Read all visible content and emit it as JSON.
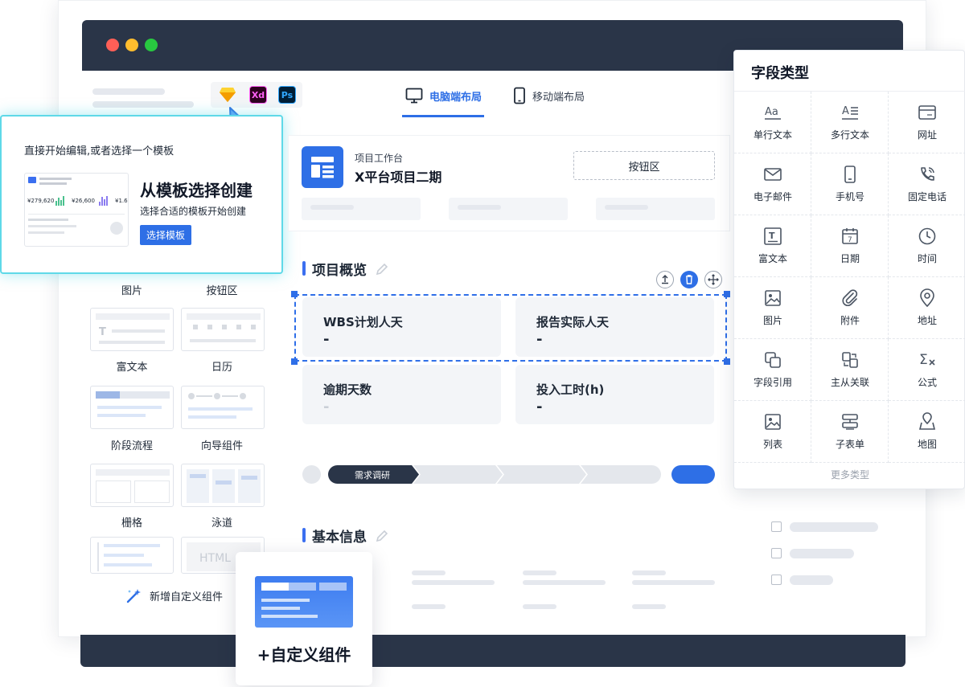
{
  "tools": [
    "Sketch",
    "Xd",
    "Ps"
  ],
  "tabs": {
    "desktop": "电脑端布局",
    "mobile": "移动端布局"
  },
  "template_panel": {
    "heading": "直接开始编辑,或者选择一个模板",
    "title": "从模板选择创建",
    "subtitle": "选择合适的模板开始创建",
    "button": "选择模板",
    "thumb_values": [
      "¥279,620",
      "¥26,600",
      "¥1.6"
    ]
  },
  "components": [
    {
      "label": "图片"
    },
    {
      "label": "按钮区"
    },
    {
      "label": "富文本"
    },
    {
      "label": "日历"
    },
    {
      "label": "阶段流程"
    },
    {
      "label": "向导组件"
    },
    {
      "label": "栅格"
    },
    {
      "label": "泳道"
    }
  ],
  "html_thumb_text": "HTML",
  "add_custom_link": "新增自定义组件",
  "add_custom_card": "+自定义组件",
  "project": {
    "workspace": "项目工作台",
    "name": "X平台项目二期",
    "button_area": "按钮区"
  },
  "overview": {
    "title": "项目概览",
    "stats": [
      {
        "label": "WBS计划人天",
        "value": "-"
      },
      {
        "label": "报告实际人天",
        "value": "-"
      },
      {
        "label": "逾期天数",
        "value": "-"
      },
      {
        "label": "投入工时(h)",
        "value": "-"
      }
    ]
  },
  "stage_bar": {
    "current": "需求调研"
  },
  "basic_info": {
    "title": "基本信息"
  },
  "field_panel": {
    "title": "字段类型",
    "fields": [
      {
        "label": "单行文本",
        "icon": "single-line-text-icon"
      },
      {
        "label": "多行文本",
        "icon": "multi-line-text-icon"
      },
      {
        "label": "网址",
        "icon": "url-icon"
      },
      {
        "label": "电子邮件",
        "icon": "email-icon"
      },
      {
        "label": "手机号",
        "icon": "mobile-phone-icon"
      },
      {
        "label": "固定电话",
        "icon": "landline-phone-icon"
      },
      {
        "label": "富文本",
        "icon": "rich-text-icon"
      },
      {
        "label": "日期",
        "icon": "calendar-icon"
      },
      {
        "label": "时间",
        "icon": "clock-icon"
      },
      {
        "label": "图片",
        "icon": "image-icon"
      },
      {
        "label": "附件",
        "icon": "paperclip-icon"
      },
      {
        "label": "地址",
        "icon": "location-pin-icon"
      },
      {
        "label": "字段引用",
        "icon": "field-reference-icon"
      },
      {
        "label": "主从关联",
        "icon": "master-detail-icon"
      },
      {
        "label": "公式",
        "icon": "formula-icon"
      },
      {
        "label": "列表",
        "icon": "list-icon"
      },
      {
        "label": "子表单",
        "icon": "sub-form-icon"
      },
      {
        "label": "地图",
        "icon": "map-icon"
      }
    ],
    "more": "更多类型"
  },
  "colors": {
    "accent": "#2e6fe6",
    "titlebar": "#2a3548",
    "glow": "#5fd9e8"
  }
}
